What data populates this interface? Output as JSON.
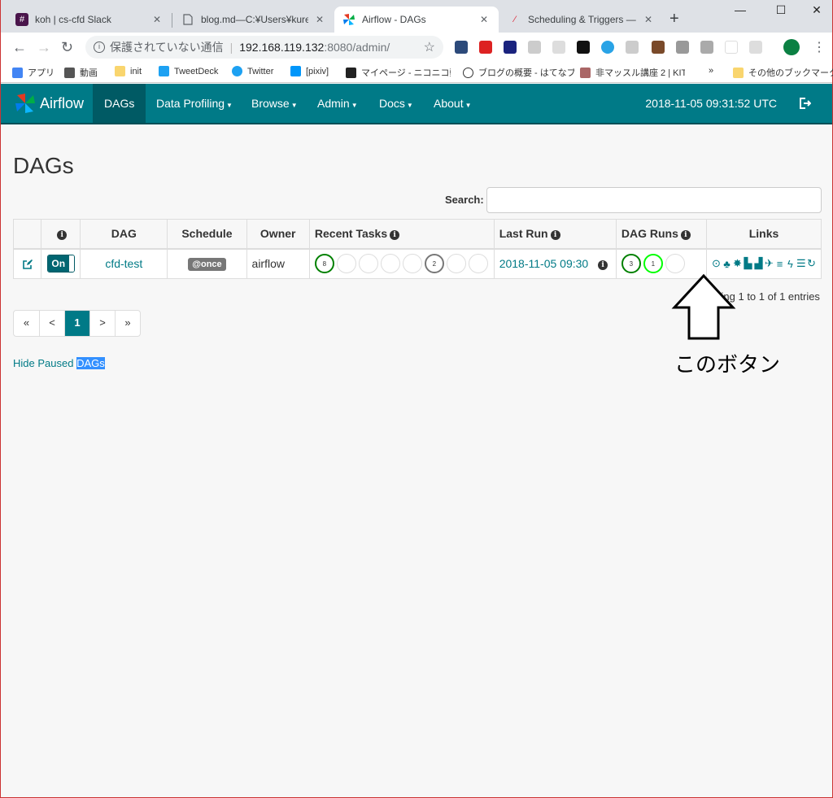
{
  "browser": {
    "tabs": [
      {
        "title": "koh | cs-cfd Slack",
        "icon": "slack-hash-icon"
      },
      {
        "title": "blog.md—C:¥Users¥kurenai",
        "icon": "document-icon"
      },
      {
        "title": "Airflow - DAGs",
        "icon": "airflow-icon",
        "active": true
      },
      {
        "title": "Scheduling & Triggers — Ai",
        "icon": "quill-icon"
      }
    ],
    "address": {
      "security_label": "保護されていない通信",
      "host": "192.168.119.132",
      "rest": ":8080/admin/"
    },
    "bookmarks": [
      "アプリ",
      "動画",
      "init",
      "TweetDeck",
      "Twitter",
      "[pixiv]",
      "マイページ - ニコニコ動画",
      "ブログの概要 - はてなブ",
      "非マッスル講座 2 | KIT",
      "»",
      "その他のブックマーク"
    ]
  },
  "navbar": {
    "brand": "Airflow",
    "items": [
      "DAGs",
      "Data Profiling",
      "Browse",
      "Admin",
      "Docs",
      "About"
    ],
    "time": "2018-11-05 09:31:52 UTC"
  },
  "page": {
    "title": "DAGs",
    "search_label": "Search:"
  },
  "table": {
    "headers": {
      "dag": "DAG",
      "schedule": "Schedule",
      "owner": "Owner",
      "recent_tasks": "Recent Tasks",
      "last_run": "Last Run",
      "dag_runs": "DAG Runs",
      "links": "Links"
    },
    "row": {
      "toggle": "On",
      "dag": "cfd-test",
      "schedule": "@once",
      "owner": "airflow",
      "recent_tasks": [
        "8",
        "",
        "",
        "",
        "",
        "2",
        "",
        ""
      ],
      "last_run": "2018-11-05 09:30",
      "dag_runs": [
        "3",
        "1",
        ""
      ]
    }
  },
  "showing": "Showing 1 to 1 of 1 entries",
  "pager": [
    "«",
    "<",
    "1",
    ">",
    "»"
  ],
  "hide_paused": {
    "prefix": "Hide Paused ",
    "selected": "DAGs"
  },
  "annotation": "このボタン",
  "colors": {
    "navbar": "#007a87",
    "success": "#008000",
    "running": "#00ff00",
    "upstream_failed": "#777777",
    "link": "#017a86"
  }
}
